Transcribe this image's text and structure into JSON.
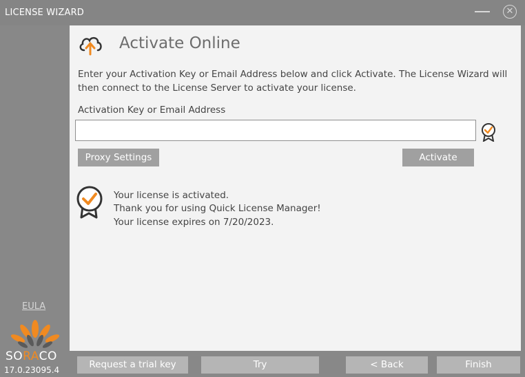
{
  "window": {
    "title": "LICENSE WIZARD"
  },
  "sidebar": {
    "eula_label": "EULA",
    "brand": {
      "part1": "SO",
      "part2": "RA",
      "part3": "CO"
    },
    "version": "17.0.23095.4"
  },
  "page": {
    "heading": "Activate Online",
    "intro": "Enter your Activation Key or Email Address below and click Activate. The License Wizard will then connect to the License Server to activate your license.",
    "field_label": "Activation Key or Email Address",
    "key_value": "",
    "proxy_button": "Proxy Settings",
    "activate_button": "Activate",
    "messages": [
      "Your license is activated.",
      "Thank you for using Quick License Manager!",
      "Your license expires on 7/20/2023."
    ]
  },
  "footer": {
    "trial_button": "Request a trial key",
    "try_button": "Try",
    "back_button": "< Back",
    "finish_button": "Finish"
  },
  "colors": {
    "accent": "#f08a21",
    "chrome": "#888888",
    "panel": "#f3f3f3",
    "button": "#a0a0a0"
  },
  "icons": [
    "cloud-upload-icon",
    "badge-check-icon",
    "minimize-icon",
    "close-icon",
    "soraco-logo"
  ]
}
